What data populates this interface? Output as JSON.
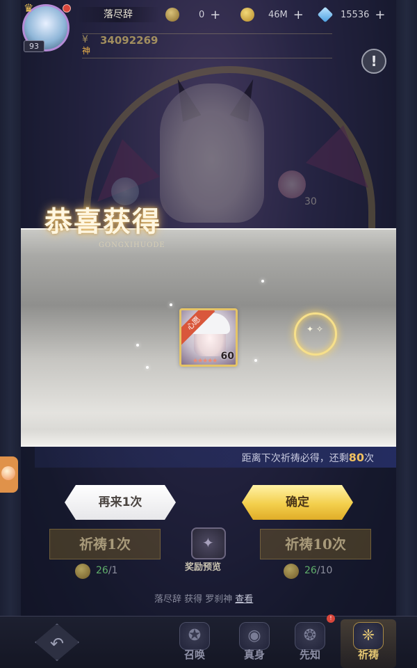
{
  "player": {
    "name": "落尽辞",
    "level": "93",
    "power": "34092269",
    "power_prefix": "¥",
    "tier_label": "神"
  },
  "resources": [
    {
      "icon": "currency-a-icon",
      "value": "0"
    },
    {
      "icon": "gold-coin-icon",
      "value": "46M"
    },
    {
      "icon": "diamond-icon",
      "value": "15536"
    }
  ],
  "info_button": "!",
  "background_hero": {
    "level": "30"
  },
  "reward_popup": {
    "title": "恭喜获得",
    "subtitle": "GONGXIHUODE",
    "item": {
      "ribbon": "心愿",
      "level": "60",
      "stars": "★★★★★"
    }
  },
  "pity": {
    "prefix": "距离下次祈祷必得，还剩",
    "count": "80",
    "suffix": "次"
  },
  "actions": {
    "again_label": "再来1次",
    "confirm_label": "确定"
  },
  "pray": {
    "single_label": "祈祷1次",
    "ten_label": "祈祷10次",
    "single_have": "26",
    "single_cost": "/1",
    "ten_have": "26",
    "ten_cost": "/10"
  },
  "reward_preview_label": "奖励预览",
  "news": {
    "text": "落尽辞 获得 罗刹神",
    "view_label": "查看"
  },
  "bottom_nav": [
    {
      "label": "召唤",
      "icon": "summon-icon"
    },
    {
      "label": "真身",
      "icon": "true-form-icon"
    },
    {
      "label": "先知",
      "icon": "prophet-icon"
    },
    {
      "label": "祈祷",
      "icon": "pray-icon"
    }
  ],
  "colors": {
    "accent_gold": "#f3cf4c",
    "pity_highlight": "#f0c060",
    "resource_have": "#5fae6a",
    "alert_red": "#d9463b"
  }
}
